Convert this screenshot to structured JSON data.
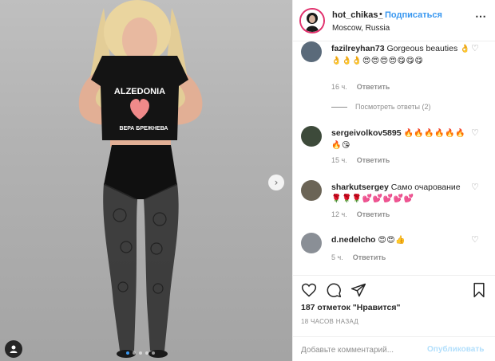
{
  "post": {
    "photo": {
      "shirt_text_top": "ALZEDONIA",
      "shirt_text_bottom": "ВЕРА БРЕЖНЕВА",
      "carousel_count": 5,
      "carousel_active": 1
    },
    "header": {
      "username": "hot_chikas_",
      "separator": "•",
      "follow_label": "Подписаться",
      "location": "Moscow, Russia",
      "more_icon": "ellipsis-icon",
      "more_glyph": "⋯"
    },
    "comments": [
      {
        "user": "fazilreyhan73",
        "text": "Gorgeous beauties",
        "emoji": "👌👌👌👌😍😍😍😍😋😋😋",
        "time": "16 ч.",
        "reply": "Ответить",
        "avatar_color": "#5a6a7a"
      },
      {
        "user": "sergeivolkov5895",
        "text": "",
        "emoji": "🔥🔥🔥🔥🔥🔥🔥😘",
        "time": "15 ч.",
        "reply": "Ответить",
        "avatar_color": "#3d4a3a"
      },
      {
        "user": "sharkutsergey",
        "text": "Само очарование",
        "emoji": "🌹🌹🌹💕💕💕💕💕",
        "time": "12 ч.",
        "reply": "Ответить",
        "avatar_color": "#6b6456"
      },
      {
        "user": "d.nedelcho",
        "text": "",
        "emoji": "😍😍👍",
        "time": "5 ч.",
        "reply": "Ответить",
        "avatar_color": "#8a8f96"
      }
    ],
    "view_replies_label": "Посмотреть ответы (2)",
    "like_icon_glyph": "♡",
    "next_glyph": "›",
    "likes_text": "187 отметок \"Нравится\"",
    "timestamp": "18 ЧАСОВ НАЗАД",
    "add_comment": {
      "placeholder": "Добавьте комментарий...",
      "publish_label": "Опубликовать"
    },
    "colors": {
      "accent": "#3897f0",
      "publish_disabled": "#b2dffc",
      "text": "#262626",
      "muted": "#8e8e8e"
    }
  }
}
